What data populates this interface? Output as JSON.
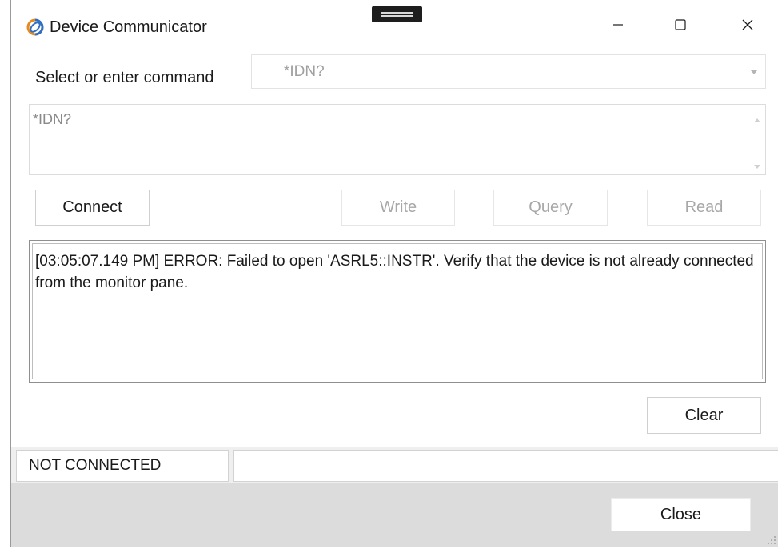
{
  "window": {
    "title": "Device Communicator",
    "icon": "app-logo-icon",
    "controls": {
      "minimize": "minimize-icon",
      "maximize": "maximize-icon",
      "close": "close-icon"
    }
  },
  "command": {
    "label": "Select or enter command",
    "selected": "*IDN?",
    "text": "*IDN?"
  },
  "buttons": {
    "connect": "Connect",
    "write": "Write",
    "query": "Query",
    "read": "Read",
    "clear": "Clear",
    "close": "Close"
  },
  "log": {
    "entry": "[03:05:07.149 PM] ERROR: Failed to open 'ASRL5::INSTR'.  Verify that the device is not already connected from the monitor pane."
  },
  "status": {
    "connection": "NOT CONNECTED",
    "detail": ""
  }
}
